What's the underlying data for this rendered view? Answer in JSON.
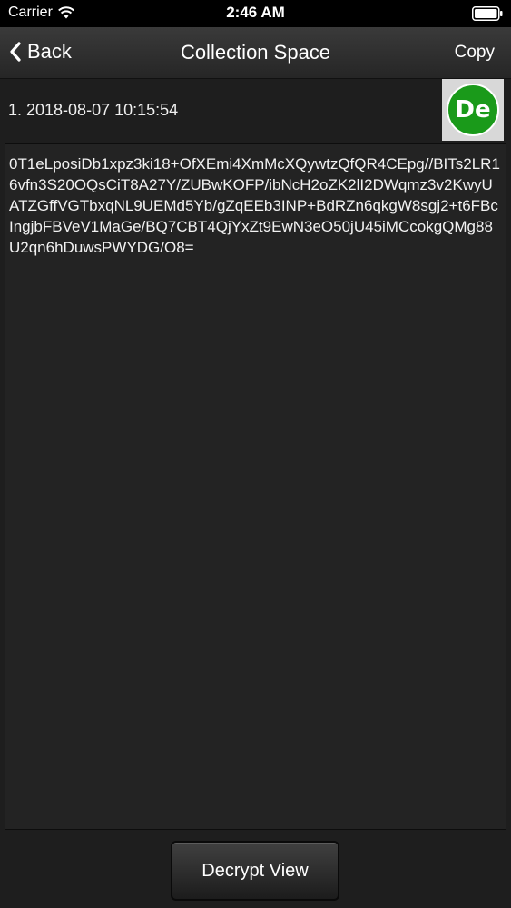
{
  "status_bar": {
    "carrier": "Carrier",
    "time": "2:46 AM"
  },
  "nav": {
    "back_label": "Back",
    "title": "Collection Space",
    "copy_label": "Copy"
  },
  "entry": {
    "label": "1. 2018-08-07 10:15:54",
    "badge_text": "De",
    "badge_color": "#1a9a1a"
  },
  "cipher": {
    "text": "0T1eLposiDb1xpz3ki18+OfXEmi4XmMcXQywtzQfQR4CEpg//BITs2LR16vfn3S20OQsCiT8A27Y/ZUBwKOFP/ibNcH2oZK2lI2DWqmz3v2KwyUATZGffVGTbxqNL9UEMd5Yb/gZqEEb3INP+BdRZn6qkgW8sgj2+t6FBcIngjbFBVeV1MaGe/BQ7CBT4QjYxZt9EwN3eO50jU45iMCcokgQMg88U2qn6hDuwsPWYDG/O8="
  },
  "footer": {
    "decrypt_label": "Decrypt View"
  },
  "icons": {
    "back": "chevron-left-icon",
    "wifi": "wifi-icon",
    "battery": "battery-icon"
  }
}
